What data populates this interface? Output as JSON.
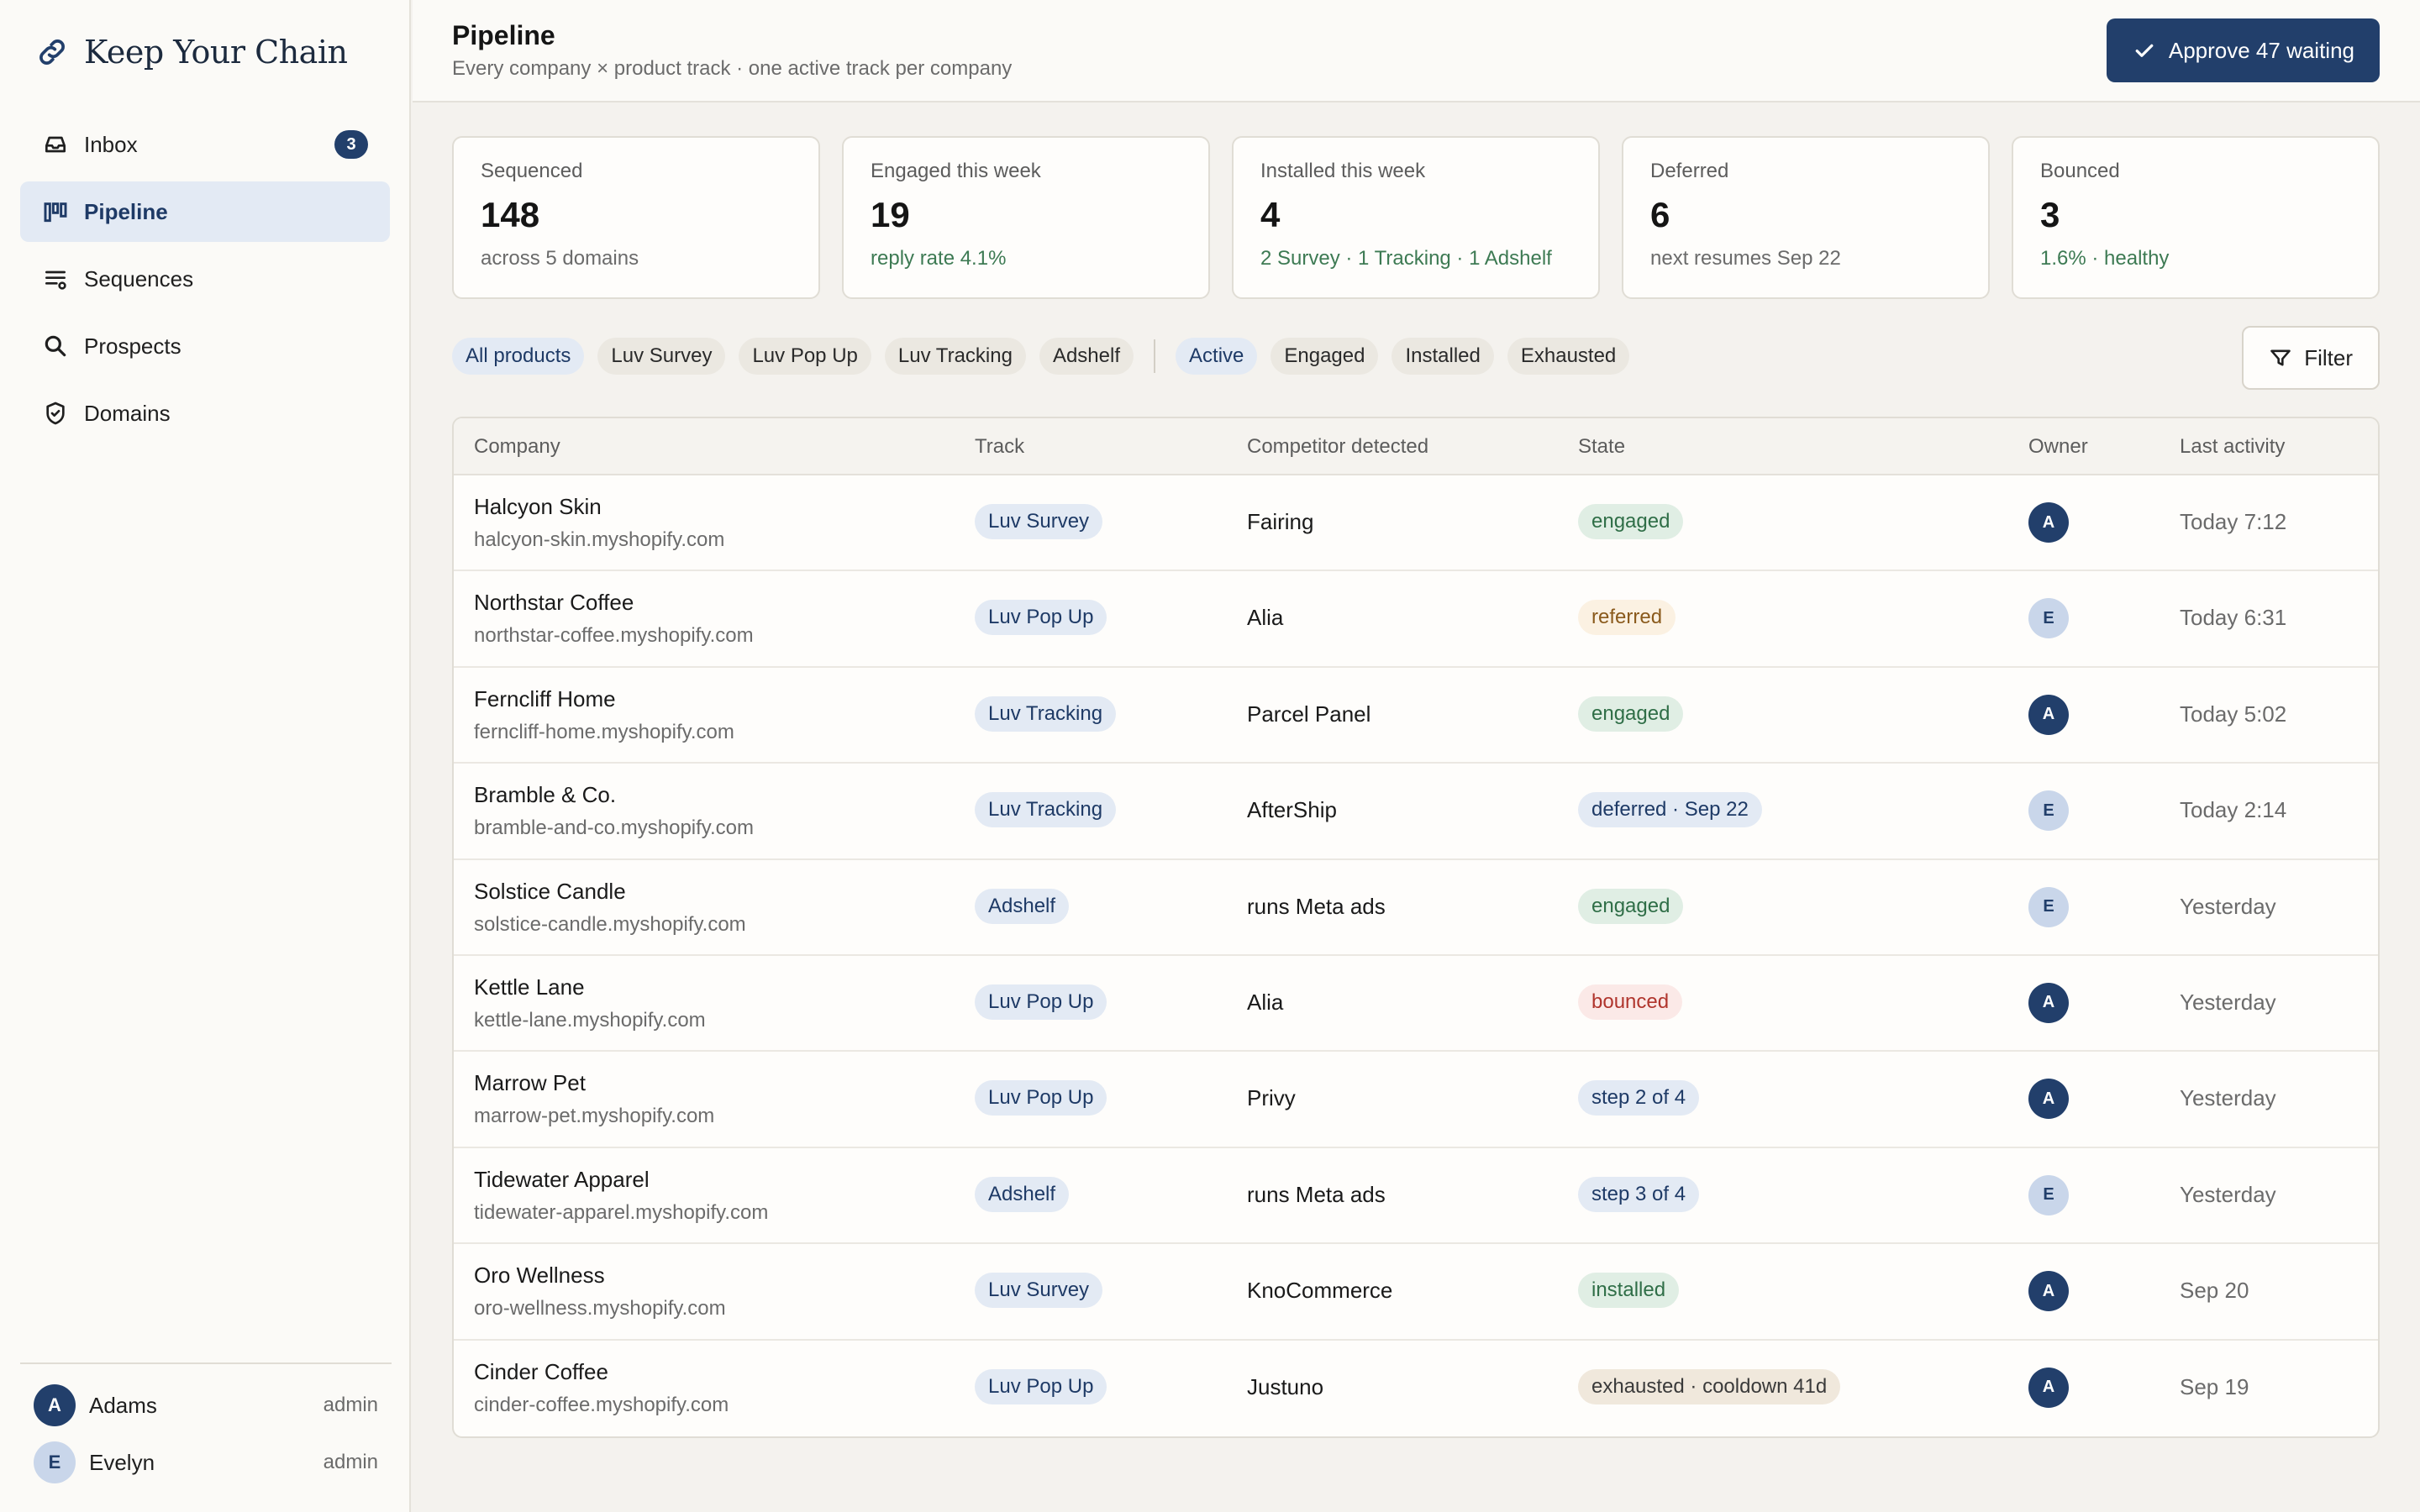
{
  "brand": {
    "name": "Keep Your Chain",
    "icon": "link-icon"
  },
  "sidebar": {
    "items": [
      {
        "label": "Inbox",
        "icon": "inbox-icon",
        "badge": "3",
        "active": false
      },
      {
        "label": "Pipeline",
        "icon": "kanban-icon",
        "active": true
      },
      {
        "label": "Sequences",
        "icon": "list-settings-icon",
        "active": false
      },
      {
        "label": "Prospects",
        "icon": "search-icon",
        "active": false
      },
      {
        "label": "Domains",
        "icon": "shield-check-icon",
        "active": false
      }
    ],
    "users": [
      {
        "initial": "A",
        "name": "Adams",
        "role": "admin"
      },
      {
        "initial": "E",
        "name": "Evelyn",
        "role": "admin"
      }
    ]
  },
  "header": {
    "title": "Pipeline",
    "subtitle": "Every company × product track · one active track per company",
    "approve_label": "Approve 47 waiting"
  },
  "stats": [
    {
      "label": "Sequenced",
      "value": "148",
      "note": "across 5 domains"
    },
    {
      "label": "Engaged this week",
      "value": "19",
      "note": "reply rate 4.1%"
    },
    {
      "label": "Installed this week",
      "value": "4",
      "note": "2 Survey · 1 Tracking · 1 Adshelf"
    },
    {
      "label": "Deferred",
      "value": "6",
      "note": "next resumes Sep 22"
    },
    {
      "label": "Bounced",
      "value": "3",
      "note": "1.6% · healthy"
    }
  ],
  "filters": {
    "products": [
      "All products",
      "Luv Survey",
      "Luv Pop Up",
      "Luv Tracking",
      "Adshelf"
    ],
    "states": [
      "Active",
      "Engaged",
      "Installed",
      "Exhausted"
    ],
    "selected_product": "All products",
    "selected_state": "Active",
    "filter_button": "Filter"
  },
  "table": {
    "columns": [
      "Company",
      "Track",
      "Competitor detected",
      "State",
      "Owner",
      "Last activity"
    ],
    "rows": [
      {
        "company": "Halcyon Skin",
        "domain": "halcyon-skin.myshopify.com",
        "track": "Luv Survey",
        "competitor": "Fairing",
        "state": "engaged",
        "state_kind": "engaged",
        "owner": "A",
        "last": "Today 7:12"
      },
      {
        "company": "Northstar Coffee",
        "domain": "northstar-coffee.myshopify.com",
        "track": "Luv Pop Up",
        "competitor": "Alia",
        "state": "referred",
        "state_kind": "referred",
        "owner": "E",
        "last": "Today 6:31"
      },
      {
        "company": "Ferncliff Home",
        "domain": "ferncliff-home.myshopify.com",
        "track": "Luv Tracking",
        "competitor": "Parcel Panel",
        "state": "engaged",
        "state_kind": "engaged",
        "owner": "A",
        "last": "Today 5:02"
      },
      {
        "company": "Bramble & Co.",
        "domain": "bramble-and-co.myshopify.com",
        "track": "Luv Tracking",
        "competitor": "AfterShip",
        "state": "deferred · Sep 22",
        "state_kind": "deferred",
        "owner": "E",
        "last": "Today 2:14"
      },
      {
        "company": "Solstice Candle",
        "domain": "solstice-candle.myshopify.com",
        "track": "Adshelf",
        "competitor": "runs Meta ads",
        "state": "engaged",
        "state_kind": "engaged",
        "owner": "E",
        "last": "Yesterday"
      },
      {
        "company": "Kettle Lane",
        "domain": "kettle-lane.myshopify.com",
        "track": "Luv Pop Up",
        "competitor": "Alia",
        "state": "bounced",
        "state_kind": "bounced",
        "owner": "A",
        "last": "Yesterday"
      },
      {
        "company": "Marrow Pet",
        "domain": "marrow-pet.myshopify.com",
        "track": "Luv Pop Up",
        "competitor": "Privy",
        "state": "step 2 of 4",
        "state_kind": "step",
        "owner": "A",
        "last": "Yesterday"
      },
      {
        "company": "Tidewater Apparel",
        "domain": "tidewater-apparel.myshopify.com",
        "track": "Adshelf",
        "competitor": "runs Meta ads",
        "state": "step 3 of 4",
        "state_kind": "step",
        "owner": "E",
        "last": "Yesterday"
      },
      {
        "company": "Oro Wellness",
        "domain": "oro-wellness.myshopify.com",
        "track": "Luv Survey",
        "competitor": "KnoCommerce",
        "state": "installed",
        "state_kind": "installed",
        "owner": "A",
        "last": "Sep 20"
      },
      {
        "company": "Cinder Coffee",
        "domain": "cinder-coffee.myshopify.com",
        "track": "Luv Pop Up",
        "competitor": "Justuno",
        "state": "exhausted · cooldown 41d",
        "state_kind": "exhausted",
        "owner": "A",
        "last": "Sep 19"
      }
    ]
  },
  "colors": {
    "accent": "#223f6b",
    "positive": "#3d7a53",
    "danger": "#b0352d"
  }
}
